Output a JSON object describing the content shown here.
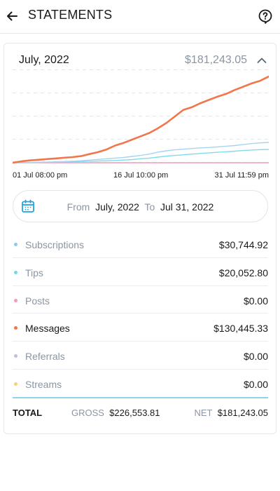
{
  "header": {
    "title": "STATEMENTS",
    "back_icon": "arrow-left-icon",
    "help_icon": "help-circle-icon"
  },
  "statement": {
    "month": "July, 2022",
    "net_total": "$181,243.05",
    "collapse_icon": "chevron-up-icon"
  },
  "range": {
    "calendar_icon": "calendar-icon",
    "from_label": "From",
    "from_value": "July, 2022",
    "to_label": "To",
    "to_value": "Jul 31, 2022"
  },
  "categories": [
    {
      "label": "Subscriptions",
      "amount": "$30,744.92",
      "color": "#8ec9ee",
      "active": false
    },
    {
      "label": "Tips",
      "amount": "$20,052.80",
      "color": "#73d9e6",
      "active": false
    },
    {
      "label": "Posts",
      "amount": "$0.00",
      "color": "#f19bb8",
      "active": false
    },
    {
      "label": "Messages",
      "amount": "$130,445.33",
      "color": "#f2764b",
      "active": true
    },
    {
      "label": "Referrals",
      "amount": "$0.00",
      "color": "#c7b8e4",
      "active": false
    },
    {
      "label": "Streams",
      "amount": "$0.00",
      "color": "#f5d07d",
      "active": false
    }
  ],
  "totals": {
    "label": "TOTAL",
    "gross_label": "GROSS",
    "gross_value": "$226,553.81",
    "net_label": "NET",
    "net_value": "$181,243.05"
  },
  "chart_data": {
    "type": "line",
    "x_tick_labels": [
      "01 Jul 08:00 pm",
      "16 Jul 10:00 pm",
      "31 Jul 11:59 pm"
    ],
    "ylim": [
      0,
      140000
    ],
    "grid": true,
    "series": [
      {
        "name": "Messages",
        "color": "#f2764b",
        "values": [
          0,
          2000,
          3500,
          4500,
          5500,
          6500,
          7500,
          8500,
          10000,
          13000,
          16000,
          20000,
          26000,
          30000,
          35000,
          40000,
          45000,
          52000,
          60000,
          70000,
          80000,
          84000,
          90000,
          95000,
          100000,
          104000,
          110000,
          115000,
          120000,
          124000,
          130445
        ]
      },
      {
        "name": "Subscriptions",
        "color": "#a8d3f0",
        "values": [
          0,
          200,
          400,
          700,
          1000,
          1400,
          1800,
          2300,
          3000,
          4000,
          5000,
          6000,
          7000,
          8000,
          9500,
          11000,
          13000,
          16000,
          18000,
          19500,
          20500,
          21500,
          22500,
          23000,
          24000,
          25000,
          26000,
          27500,
          29000,
          30000,
          30745
        ]
      },
      {
        "name": "Tips",
        "color": "#7fdde9",
        "values": [
          0,
          100,
          200,
          400,
          600,
          800,
          1100,
          1400,
          1800,
          2200,
          2600,
          3000,
          3500,
          4000,
          4800,
          6000,
          7000,
          8500,
          10000,
          11000,
          12000,
          13000,
          14000,
          15000,
          15800,
          16500,
          17500,
          18500,
          19200,
          19800,
          20053
        ]
      },
      {
        "name": "Posts",
        "color": "#f19bb8",
        "values": [
          0,
          0,
          0,
          0,
          0,
          0,
          0,
          0,
          0,
          0,
          0,
          0,
          0,
          0,
          0,
          0,
          0,
          0,
          0,
          0,
          0,
          0,
          0,
          0,
          0,
          0,
          0,
          0,
          0,
          0,
          0
        ]
      }
    ]
  }
}
